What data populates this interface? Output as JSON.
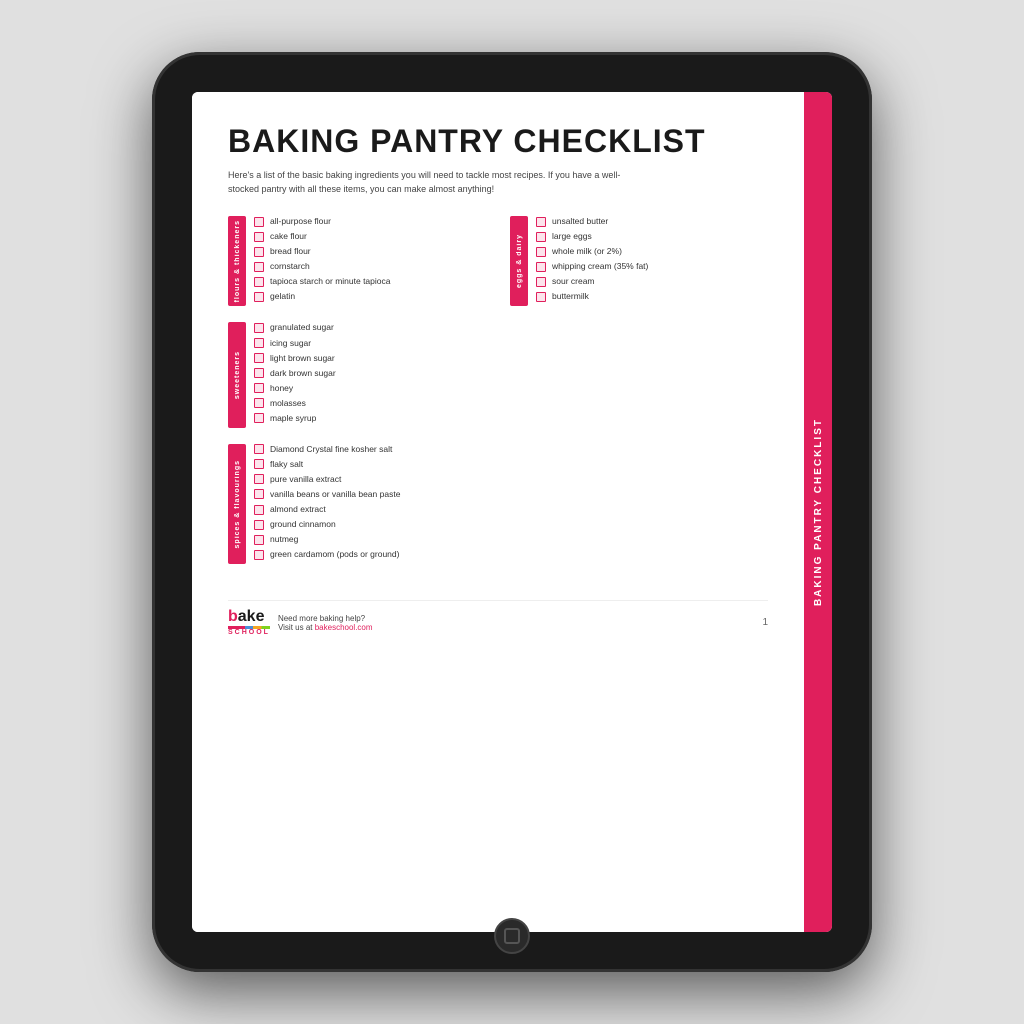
{
  "tablet": {
    "sidebar_label": "BAKING PANTRY CHECKLIST"
  },
  "document": {
    "title": "BAKING PANTRY CHECKLIST",
    "subtitle": "Here's a list of the basic baking ingredients you will need to tackle most recipes. If you have a well-stocked pantry with all these items, you can make almost anything!",
    "sections": [
      {
        "id": "flours",
        "label": "flours & thickeners",
        "items": [
          "all-purpose flour",
          "cake flour",
          "bread flour",
          "cornstarch",
          "tapioca starch or minute tapioca",
          "gelatin"
        ]
      },
      {
        "id": "eggs",
        "label": "eggs & dairy",
        "items": [
          "unsalted butter",
          "large eggs",
          "whole milk (or 2%)",
          "whipping cream (35% fat)",
          "sour cream",
          "buttermilk"
        ]
      },
      {
        "id": "sweeteners",
        "label": "sweeteners",
        "items": [
          "granulated sugar",
          "icing sugar",
          "light brown sugar",
          "dark brown sugar",
          "honey",
          "molasses",
          "maple syrup"
        ]
      },
      {
        "id": "spices",
        "label": "spices & flavourings",
        "items": [
          "Diamond Crystal fine kosher salt",
          "flaky salt",
          "pure vanilla extract",
          "vanilla beans or vanilla bean paste",
          "almond extract",
          "ground cinnamon",
          "nutmeg",
          "green cardamom (pods or ground)"
        ]
      }
    ],
    "footer": {
      "logo_bake": "bake",
      "logo_school": "SCHOOL",
      "footer_text_line1": "Need more baking help?",
      "footer_text_line2": "Visit us at ",
      "footer_link": "bakeschool.com",
      "page_number": "1"
    }
  }
}
